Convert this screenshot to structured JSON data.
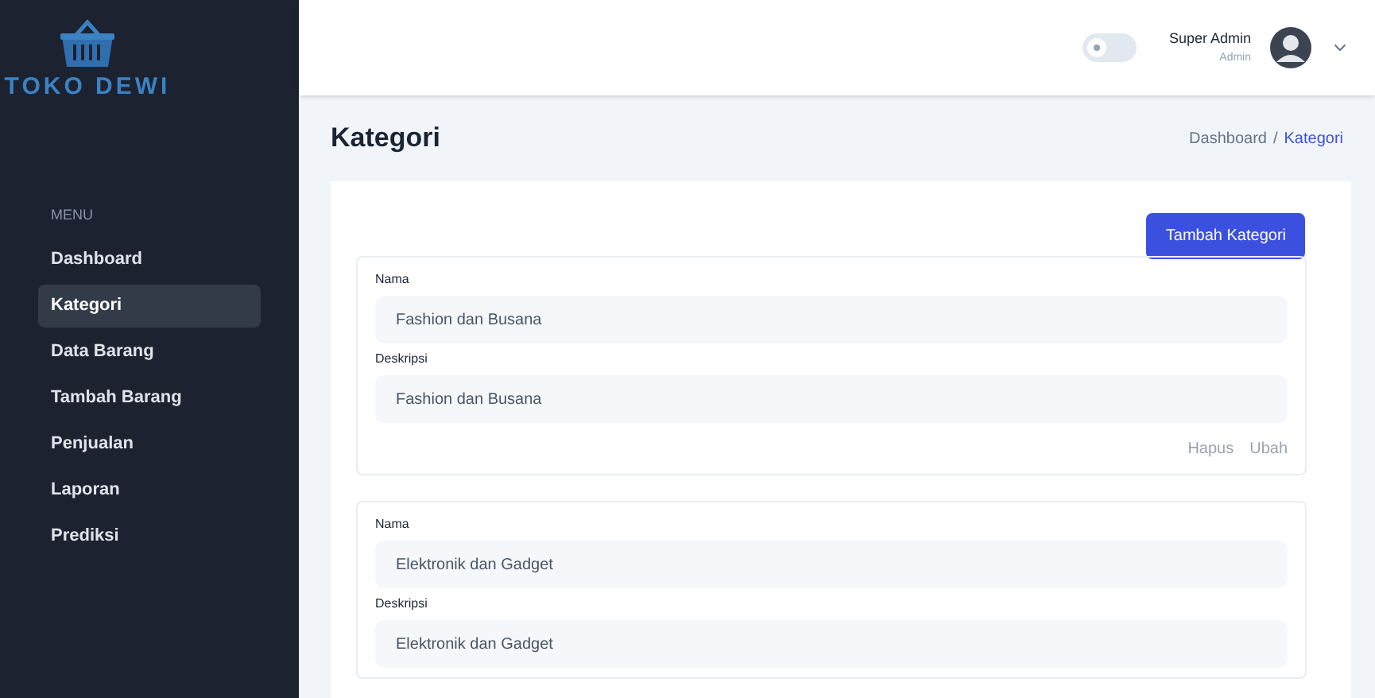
{
  "sidebar": {
    "brand": "TOKO DEWI",
    "menu_heading": "MENU",
    "items": [
      {
        "label": "Dashboard",
        "selected": false
      },
      {
        "label": "Kategori",
        "selected": true
      },
      {
        "label": "Data Barang",
        "selected": false
      },
      {
        "label": "Tambah Barang",
        "selected": false
      },
      {
        "label": "Penjualan",
        "selected": false
      },
      {
        "label": "Laporan",
        "selected": false
      },
      {
        "label": "Prediksi",
        "selected": false
      }
    ]
  },
  "header": {
    "dark_mode_toggle": {
      "on": false
    },
    "user": {
      "name": "Super Admin",
      "role": "Admin"
    }
  },
  "page": {
    "title": "Kategori",
    "breadcrumb": [
      {
        "label": "Dashboard",
        "selected": false
      },
      {
        "label": "Kategori",
        "selected": true
      }
    ],
    "separator": "/"
  },
  "add_button": "Tambah Kategori",
  "categories": [
    {
      "name_label": "Nama",
      "name": "Fashion dan Busana",
      "description_label": "Deskripsi",
      "description": "Fashion dan Busana",
      "actions": [
        "Hapus",
        "Ubah"
      ]
    },
    {
      "name_label": "Nama",
      "name": "Elektronik dan Gadget",
      "description_label": "Deskripsi",
      "description": "Elektronik dan Gadget"
    }
  ]
}
